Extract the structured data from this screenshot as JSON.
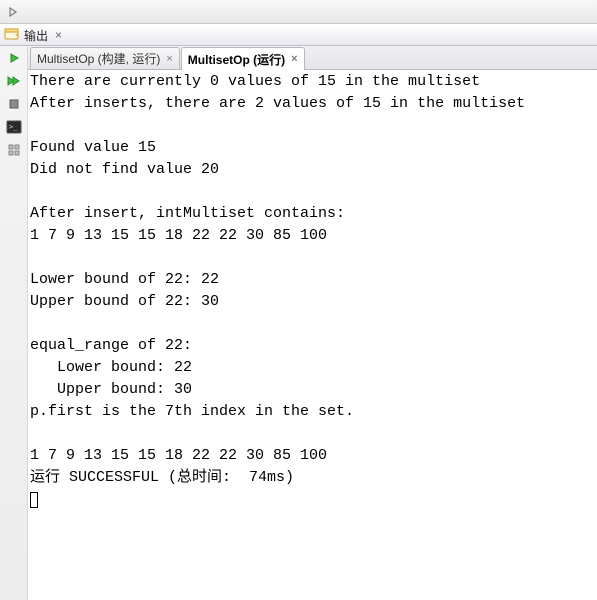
{
  "toolbar": {
    "play_arrow": "play"
  },
  "panel": {
    "title": "输出",
    "close": "×"
  },
  "gutter": {
    "play": "play-icon",
    "double_play": "double-play-icon",
    "stop": "stop-icon",
    "terminal": "terminal-icon",
    "props": "properties-icon"
  },
  "tabs": [
    {
      "label": "MultisetOp (构建, 运行)",
      "active": false
    },
    {
      "label": "MultisetOp (运行)",
      "active": true
    }
  ],
  "console_lines": [
    "There are currently 0 values of 15 in the multiset",
    "After inserts, there are 2 values of 15 in the multiset",
    "",
    "Found value 15",
    "Did not find value 20",
    "",
    "After insert, intMultiset contains:",
    "1 7 9 13 15 15 18 22 22 30 85 100 ",
    "",
    "Lower bound of 22: 22",
    "Upper bound of 22: 30",
    "",
    "equal_range of 22:",
    "   Lower bound: 22",
    "   Upper bound: 30",
    "p.first is the 7th index in the set.",
    "",
    "1 7 9 13 15 15 18 22 22 30 85 100 ",
    "运行 SUCCESSFUL (总时间:  74ms)"
  ]
}
